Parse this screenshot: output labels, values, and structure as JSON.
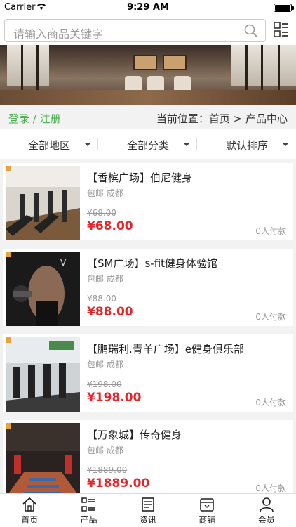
{
  "status_bar": {
    "carrier": "Carrier",
    "time": "9:29 AM"
  },
  "search": {
    "placeholder": "请输入商品关键字"
  },
  "location_bar": {
    "login_register": "登录 / 注册",
    "breadcrumb": "当前位置：首页 > 产品中心"
  },
  "filters": [
    {
      "label": "全部地区"
    },
    {
      "label": "全部分类"
    },
    {
      "label": "默认排序"
    }
  ],
  "products": [
    {
      "name": "【香槟广场】伯尼健身",
      "shipping": "包邮 成都",
      "original_price": "¥68.00",
      "price": "¥68.00",
      "paid_count": "0人付款"
    },
    {
      "name": "【SM广场】s-fit健身体验馆",
      "shipping": "包邮 成都",
      "original_price": "¥88.00",
      "price": "¥88.00",
      "paid_count": "0人付款"
    },
    {
      "name": "【鹏瑞利.青羊广场】e健身俱乐部",
      "shipping": "包邮 成都",
      "original_price": "¥198.00",
      "price": "¥198.00",
      "paid_count": "0人付款"
    },
    {
      "name": "【万象城】传奇健身",
      "shipping": "包邮 成都",
      "original_price": "¥1889.00",
      "price": "¥1889.00",
      "paid_count": "0人付款"
    }
  ],
  "tabbar": [
    {
      "label": "首页",
      "icon": "home-icon"
    },
    {
      "label": "产品",
      "icon": "list-icon"
    },
    {
      "label": "资讯",
      "icon": "news-icon"
    },
    {
      "label": "商铺",
      "icon": "store-icon"
    },
    {
      "label": "会员",
      "icon": "user-icon"
    }
  ],
  "colors": {
    "accent_green": "#4caf50",
    "price_red": "#e4262a"
  }
}
